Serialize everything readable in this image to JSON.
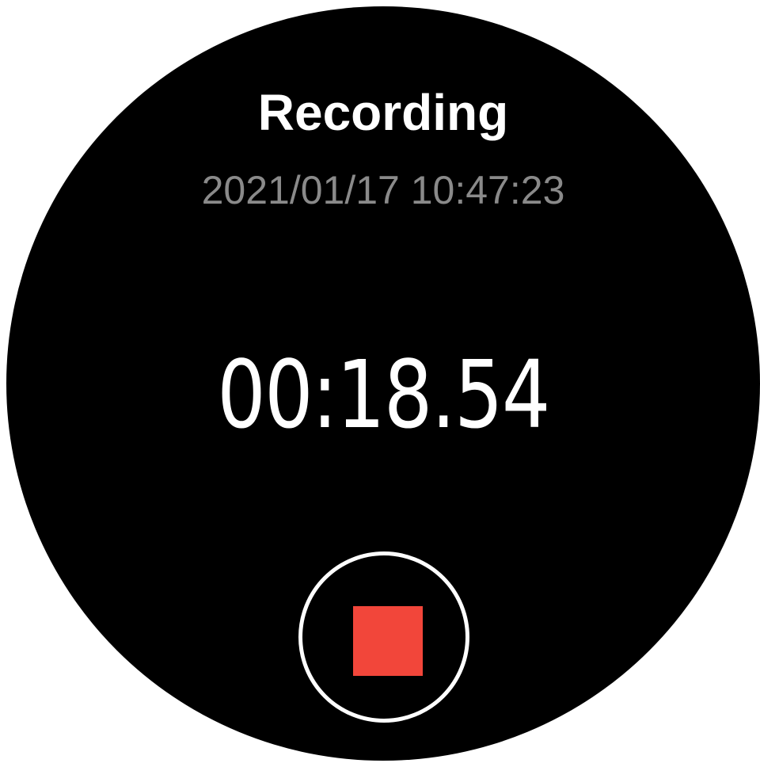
{
  "recorder": {
    "title": "Recording",
    "timestamp": "2021/01/17 10:47:23",
    "elapsed": "00:18.54"
  },
  "controls": {
    "stop_icon": "stop-icon",
    "stop_color": "#f2463a"
  },
  "colors": {
    "background": "#000000",
    "primary_text": "#ffffff",
    "secondary_text": "#8a8a8a"
  }
}
